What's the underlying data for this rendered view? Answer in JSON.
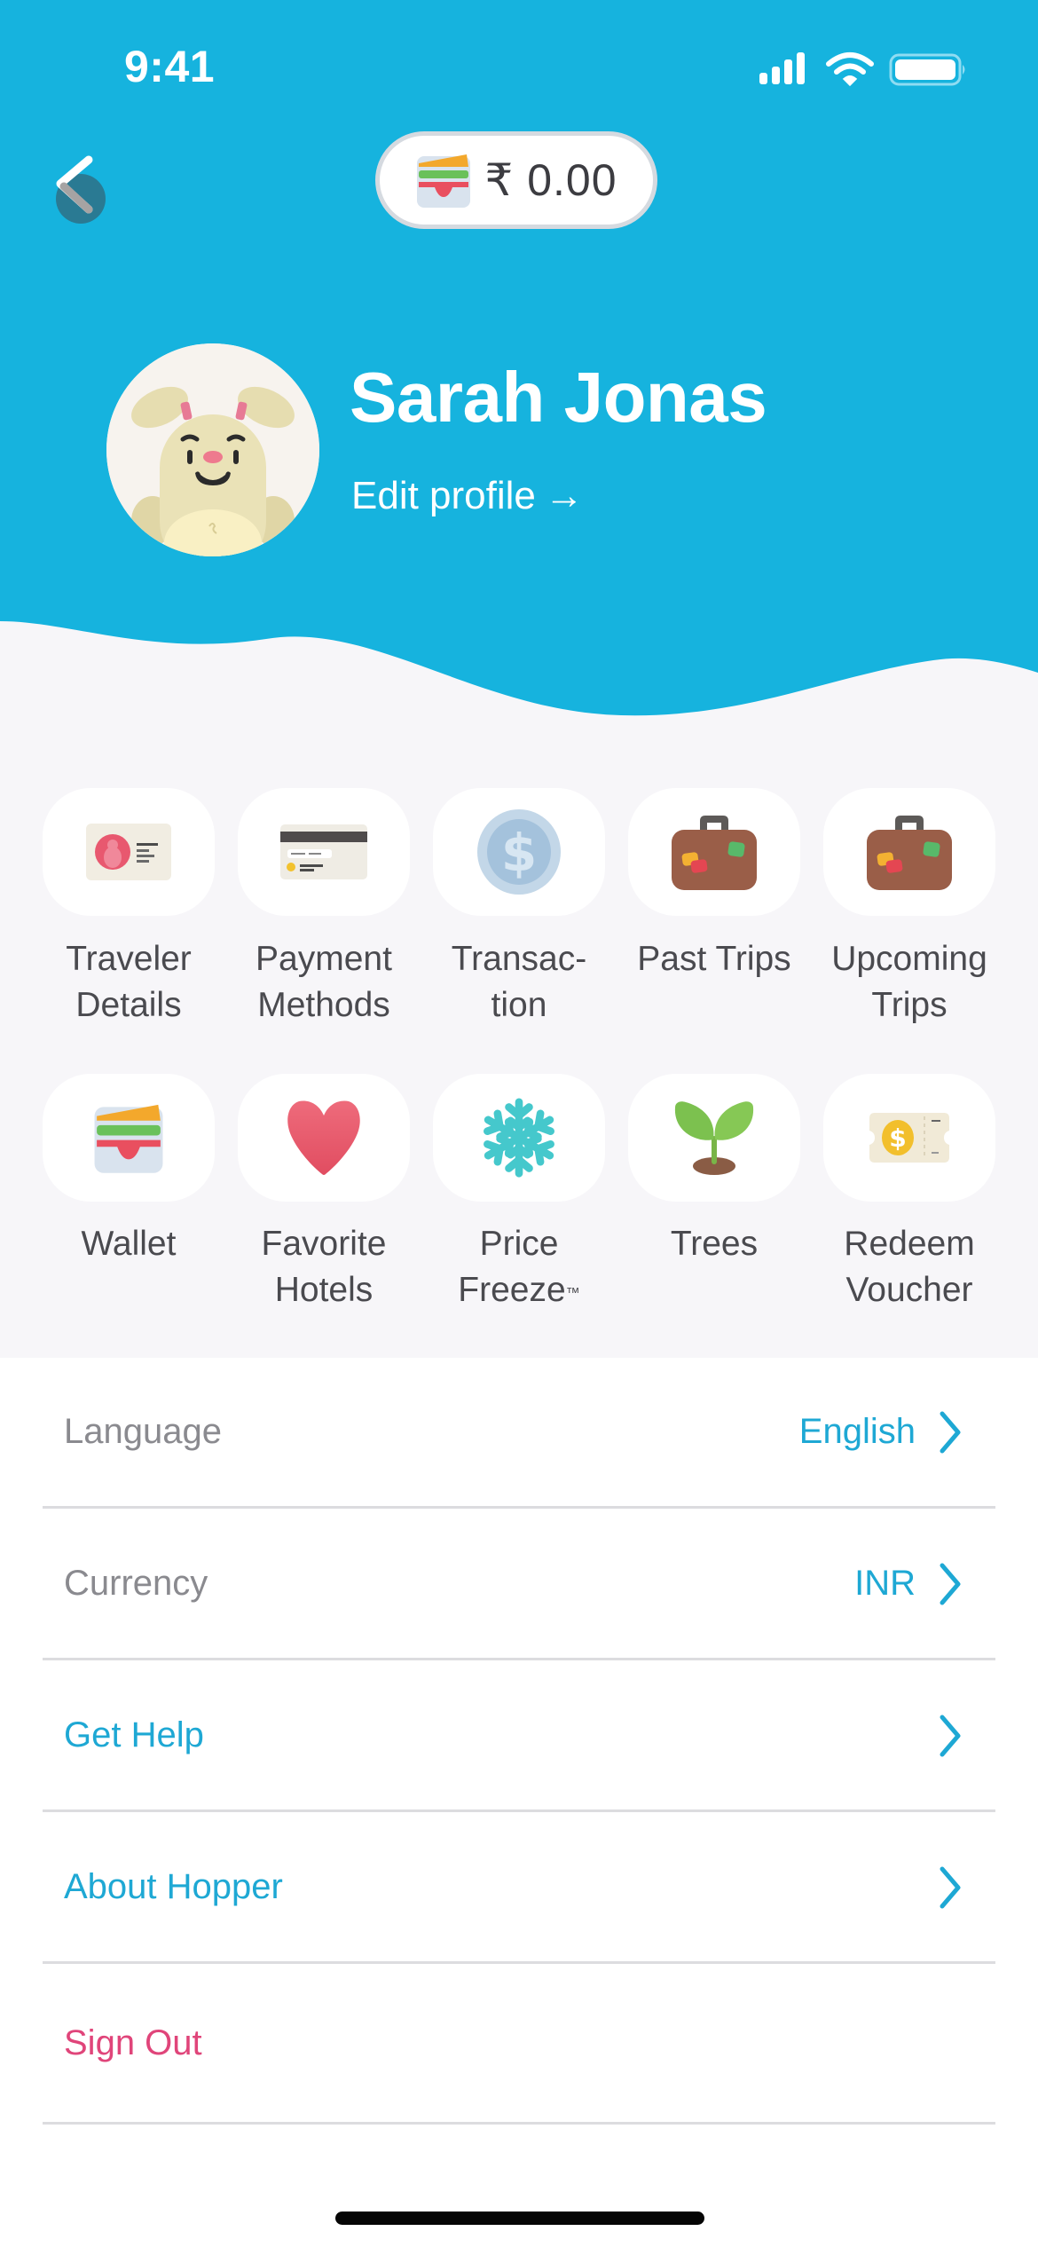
{
  "status_bar": {
    "time": "9:41"
  },
  "colors": {
    "brand_blue": "#16b3de",
    "link_blue": "#1ea8d4",
    "muted_text": "#8a8a8f",
    "grid_text": "#4a4a4f",
    "danger": "#e0457a",
    "surface": "#f7f6f9"
  },
  "header": {
    "back_icon": "chevron-left-icon",
    "wallet": {
      "icon": "wallet-icon",
      "amount": "₹ 0.00"
    },
    "profile": {
      "avatar": "bunny-avatar",
      "name": "Sarah Jonas",
      "edit_label": "Edit profile",
      "edit_arrow": "→"
    }
  },
  "grid": [
    {
      "label": "Traveler\nDetails",
      "icon": "id-card-icon"
    },
    {
      "label": "Payment\nMethods",
      "icon": "credit-card-icon"
    },
    {
      "label": "Transac-\ntion",
      "icon": "coin-icon"
    },
    {
      "label": "Past Trips",
      "icon": "suitcase-icon"
    },
    {
      "label": "Upcoming\nTrips",
      "icon": "suitcase-icon"
    },
    {
      "label": "Wallet",
      "icon": "wallet-icon"
    },
    {
      "label": "Favorite\nHotels",
      "icon": "heart-icon"
    },
    {
      "label": "Price\nFreeze",
      "label_suffix": "™",
      "icon": "snowflake-icon"
    },
    {
      "label": "Trees",
      "icon": "sprout-icon"
    },
    {
      "label": "Redeem\nVoucher",
      "icon": "voucher-icon"
    }
  ],
  "settings": [
    {
      "label": "Language",
      "value": "English",
      "style": "muted"
    },
    {
      "label": "Currency",
      "value": "INR",
      "style": "muted"
    },
    {
      "label": "Get Help",
      "value": "",
      "style": "link"
    },
    {
      "label": "About Hopper",
      "value": "",
      "style": "link"
    },
    {
      "label": "Sign Out",
      "value": "",
      "style": "danger"
    }
  ]
}
